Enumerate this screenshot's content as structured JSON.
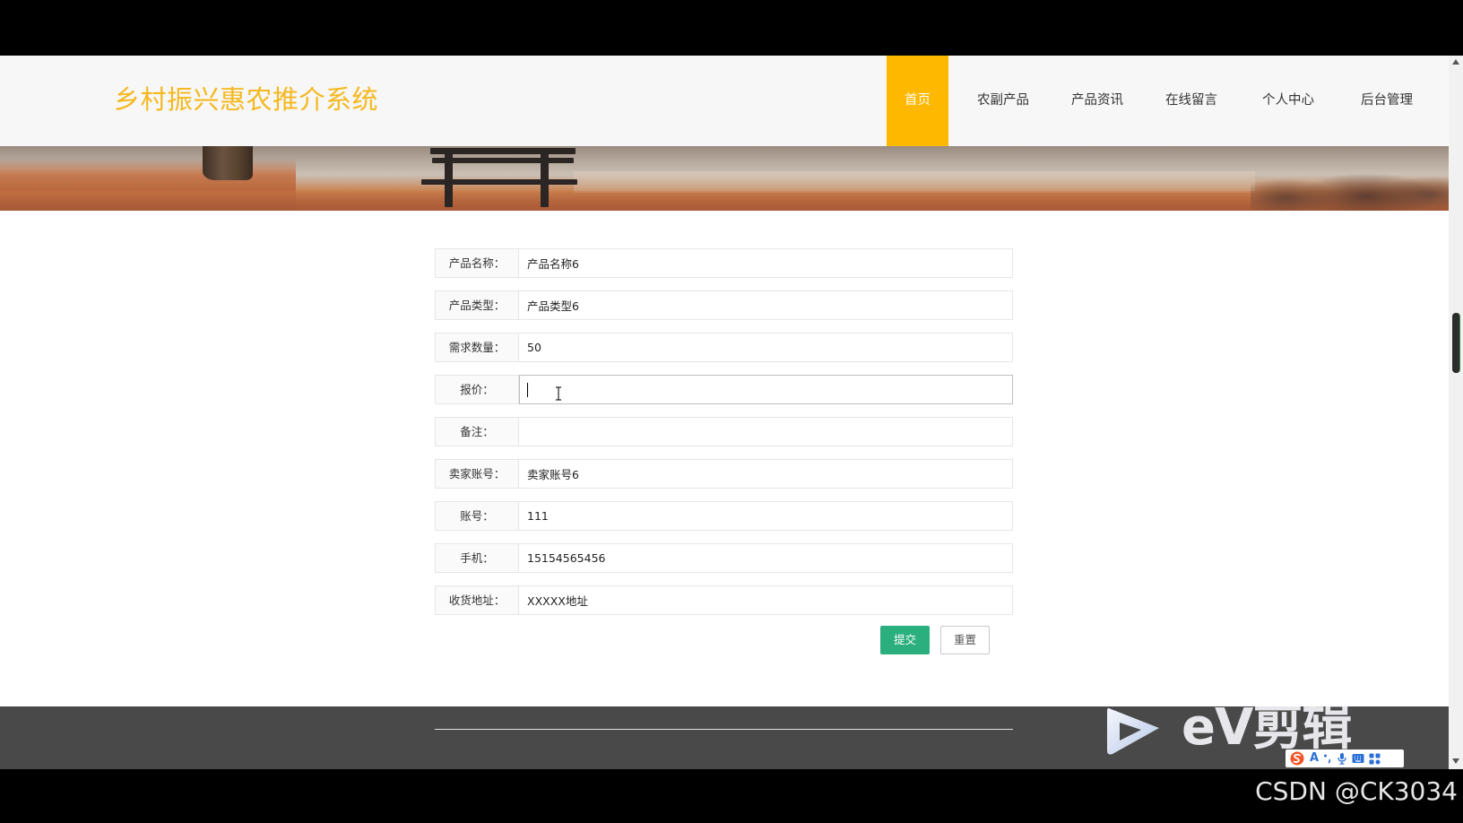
{
  "header": {
    "title": "乡村振兴惠农推介系统",
    "nav": [
      {
        "label": "首页",
        "active": true
      },
      {
        "label": "农副产品",
        "active": false
      },
      {
        "label": "产品资讯",
        "active": false
      },
      {
        "label": "在线留言",
        "active": false
      },
      {
        "label": "个人中心",
        "active": false
      },
      {
        "label": "后台管理",
        "active": false
      }
    ]
  },
  "form": {
    "fields": [
      {
        "label": "产品名称：",
        "value": "产品名称6"
      },
      {
        "label": "产品类型：",
        "value": "产品类型6"
      },
      {
        "label": "需求数量：",
        "value": "50"
      },
      {
        "label": "报价：",
        "value": "",
        "focused": true
      },
      {
        "label": "备注：",
        "value": ""
      },
      {
        "label": "卖家账号：",
        "value": "卖家账号6"
      },
      {
        "label": "账号：",
        "value": "111"
      },
      {
        "label": "手机：",
        "value": "15154565456"
      },
      {
        "label": "收货地址：",
        "value": "XXXXX地址"
      }
    ],
    "submit_label": "提交",
    "reset_label": "重置"
  },
  "overlays": {
    "ev_logo_text": "eV剪辑",
    "ime_mode": "A",
    "csdn_watermark": "CSDN @CK3034"
  },
  "icons": [
    "text-cursor-icon",
    "play-icon",
    "sogou-s-icon",
    "punctuation-icon",
    "mic-icon",
    "keyboard-icon",
    "grid-icon",
    "scroll-up-icon",
    "scroll-down-icon"
  ],
  "colors": {
    "brand": "#F5B81F",
    "nav_active_bg": "#FFB800",
    "submit_bg": "#2BAF7E",
    "footer_bg": "#494949"
  }
}
